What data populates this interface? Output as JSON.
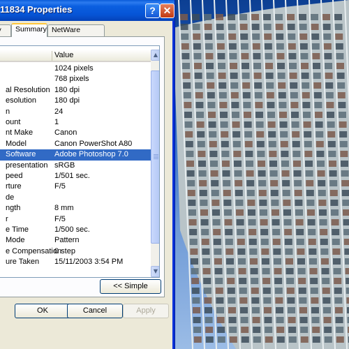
{
  "window": {
    "title": "11834 Properties",
    "help_glyph": "?",
    "close_glyph": "✕"
  },
  "tabs": [
    {
      "label": "nily"
    },
    {
      "label": "Summary"
    },
    {
      "label": "NetWare Version"
    }
  ],
  "list": {
    "columns": {
      "property": "",
      "value": "Value"
    },
    "rows": [
      {
        "property": "",
        "value": "1024 pixels"
      },
      {
        "property": "",
        "value": "768 pixels"
      },
      {
        "property": "al Resolution",
        "value": "180 dpi"
      },
      {
        "property": "esolution",
        "value": "180 dpi"
      },
      {
        "property": "n",
        "value": "24"
      },
      {
        "property": "ount",
        "value": "1"
      },
      {
        "property": "nt Make",
        "value": "Canon"
      },
      {
        "property": "Model",
        "value": "Canon PowerShot A80"
      },
      {
        "property": "Software",
        "value": "Adobe Photoshop 7.0"
      },
      {
        "property": "presentation",
        "value": "sRGB"
      },
      {
        "property": "peed",
        "value": "1/501 sec."
      },
      {
        "property": "rture",
        "value": "F/5"
      },
      {
        "property": "de",
        "value": ""
      },
      {
        "property": "ngth",
        "value": "8 mm"
      },
      {
        "property": "r",
        "value": "F/5"
      },
      {
        "property": "e Time",
        "value": "1/500 sec."
      },
      {
        "property": "Mode",
        "value": "Pattern"
      },
      {
        "property": "e Compensation",
        "value": "0 step"
      },
      {
        "property": "ure Taken",
        "value": "15/11/2003 3:54 PM"
      }
    ],
    "selected_index": 8
  },
  "buttons": {
    "simple": "<< Simple",
    "ok": "OK",
    "cancel": "Cancel",
    "apply": "Apply"
  },
  "colors": {
    "titlebar": "#0654d6",
    "selection": "#316ac5",
    "dialog": "#ece9d8"
  },
  "icons": {
    "help": "help-icon",
    "close": "close-icon",
    "scroll_up": "arrow-up-icon",
    "scroll_down": "arrow-down-icon"
  }
}
